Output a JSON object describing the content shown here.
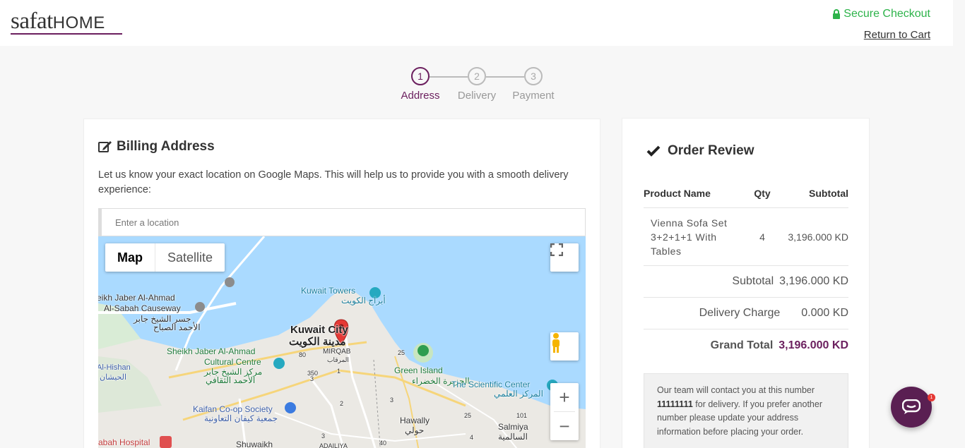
{
  "header": {
    "logo_main": "safat",
    "logo_sub": "HOME",
    "secure_label": "Secure Checkout",
    "return_label": "Return to Cart",
    "secure_color": "#2db34a"
  },
  "steps": [
    {
      "num": "1",
      "label": "Address",
      "active": true
    },
    {
      "num": "2",
      "label": "Delivery",
      "active": false
    },
    {
      "num": "3",
      "label": "Payment",
      "active": false
    }
  ],
  "billing": {
    "title": "Billing Address",
    "description": "Let us know your exact location on Google Maps. This will help us to provide you with a smooth delivery experience:",
    "location_placeholder": "Enter a location"
  },
  "map": {
    "type_map": "Map",
    "type_satellite": "Satellite",
    "zoom_in": "+",
    "zoom_out": "−",
    "labels": {
      "causeway_1": "eikh Jaber Al-Ahmad",
      "causeway_2": "Al-Sabah Causeway",
      "causeway_ar1": "جسر الشيخ جابر",
      "causeway_ar2": "الأحمد الصباح",
      "towers": "Kuwait Towers",
      "towers_ar": "أبراج الكويت",
      "city": "Kuwait City",
      "city_ar": "مدينة الكويت",
      "mirqab": "MIRQAB",
      "mirqab_ar": "المرقاب",
      "cultural_1": "Sheikh Jaber Al-Ahmad",
      "cultural_2": "Cultural Centre",
      "cultural_ar1": "مركز الشيخ جابر",
      "cultural_ar2": "الأحمد الثقافي",
      "green_island": "Green Island",
      "green_island_ar": "الجزيرة الخضراء",
      "sci_center": "The Scientific Center",
      "sci_center_ar": "المركز العلمي",
      "hishan": "Al-Hishan",
      "hishan_ar": "الحيشان",
      "kaifan": "Kaifan Co-op Society",
      "kaifan_ar": "جمعية كيفان التعاونية",
      "hawally": "Hawally",
      "hawally_ar": "حولي",
      "salmiya": "Salmiya",
      "salmiya_ar": "السالمية",
      "hospital": "abah Hospital",
      "shuwaikh": "Shuwaikh",
      "adailiya": "ADAILIYA",
      "r25a": "25",
      "r80": "80",
      "r350": "350",
      "r1": "1",
      "r2": "2",
      "r3": "3",
      "r3b": "3",
      "r25b": "25",
      "r101": "101",
      "r4": "4",
      "r40": "40",
      "r3c": "3"
    }
  },
  "order": {
    "title": "Order Review",
    "col_product": "Product Name",
    "col_qty": "Qty",
    "col_subtotal": "Subtotal",
    "items": [
      {
        "name": "Vienna Sofa Set 3+2+1+1 With Tables",
        "qty": "4",
        "subtotal": "3,196.000 KD"
      }
    ],
    "subtotal_label": "Subtotal",
    "subtotal_value": "3,196.000 KD",
    "delivery_label": "Delivery Charge",
    "delivery_value": "0.000 KD",
    "grand_label": "Grand Total",
    "grand_value": "3,196.000 KD",
    "notice_pre": "Our team will contact you at this number",
    "notice_phone": "11111111",
    "notice_post": "for delivery. If you prefer another number please update your address information before placing your order."
  },
  "chat": {
    "badge": "1"
  },
  "colors": {
    "brand": "#6b1f5e",
    "secure": "#2db34a"
  }
}
